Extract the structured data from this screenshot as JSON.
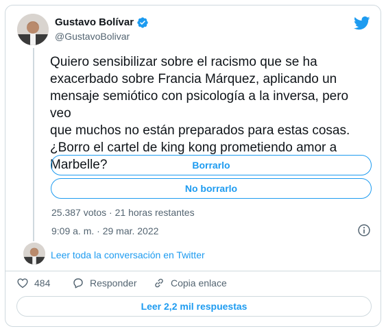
{
  "author": {
    "name": "Gustavo Bolívar",
    "handle": "@GustavoBolivar",
    "verified": true
  },
  "tweet": {
    "text": "Quiero sensibilizar sobre el racismo que se ha\nexacerbado sobre Francia Márquez, aplicando un\nmensaje semiótico con psicología a la inversa, pero veo\nque muchos no están preparados para estas cosas.\n¿Borro el cartel de king kong prometiendo amor a\nMarbelle?"
  },
  "poll": {
    "options": [
      "Borrarlo",
      "No borrarlo"
    ],
    "meta": "25.387 votos · 21 horas restantes"
  },
  "timestamp": "9:09 a. m. · 29 mar. 2022",
  "conversation_link": "Leer toda la conversación en Twitter",
  "actions": {
    "likes": "484",
    "reply_label": "Responder",
    "share_label": "Copia enlace"
  },
  "replies_button": "Leer 2,2 mil respuestas",
  "icons": {
    "verified": "verified-badge-icon",
    "logo": "twitter-bird-icon",
    "info": "info-icon",
    "like": "heart-icon",
    "reply": "speech-bubble-icon",
    "share": "link-icon"
  },
  "colors": {
    "accent": "#1d9bf0",
    "text": "#0f1419",
    "secondary": "#536471",
    "border": "#cfd9de"
  }
}
